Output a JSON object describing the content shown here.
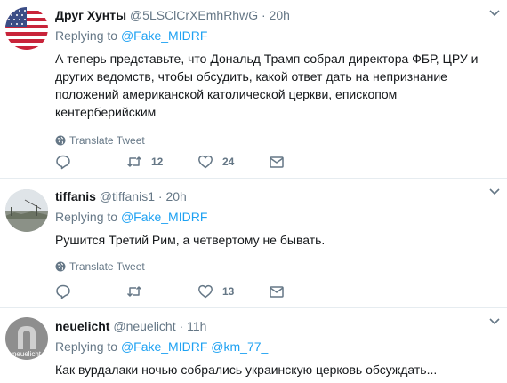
{
  "tweets": [
    {
      "name": "Друг Хунты",
      "handle": "@5LSClCrXEmhRhwG",
      "time": "20h",
      "replying_to_label": "Replying to ",
      "replying_to": [
        "@Fake_MIDRF"
      ],
      "text": "А теперь представьте, что Дональд Трамп собрал директора ФБР, ЦРУ и других ведомств, чтобы обсудить, какой ответ дать на непризнание положений американской католической церкви, епископом кентерберийским",
      "translate": "Translate Tweet",
      "replies": "",
      "retweets": "12",
      "likes": "24",
      "avatar": "us-flag"
    },
    {
      "name": "tiffanis",
      "handle": "@tiffanis1",
      "time": "20h",
      "replying_to_label": "Replying to ",
      "replying_to": [
        "@Fake_MIDRF"
      ],
      "text": "Рушится Третий Рим, а четвертому  не бывать.",
      "translate": "Translate Tweet",
      "replies": "",
      "retweets": "",
      "likes": "13",
      "avatar": "photo-field"
    },
    {
      "name": "neuelicht",
      "handle": "@neuelicht",
      "time": "11h",
      "replying_to_label": "Replying to ",
      "replying_to": [
        "@Fake_MIDRF",
        "@km_77_"
      ],
      "text": "Как вурдалаки ночью собрались украинскую церковь обсуждать...",
      "avatar_text": "neuelicht",
      "avatar": "logo-n"
    }
  ],
  "separator": " · ",
  "colors": {
    "link": "#1da1f2",
    "muted": "#657786",
    "text": "#14171a",
    "border": "#e6ecf0"
  }
}
